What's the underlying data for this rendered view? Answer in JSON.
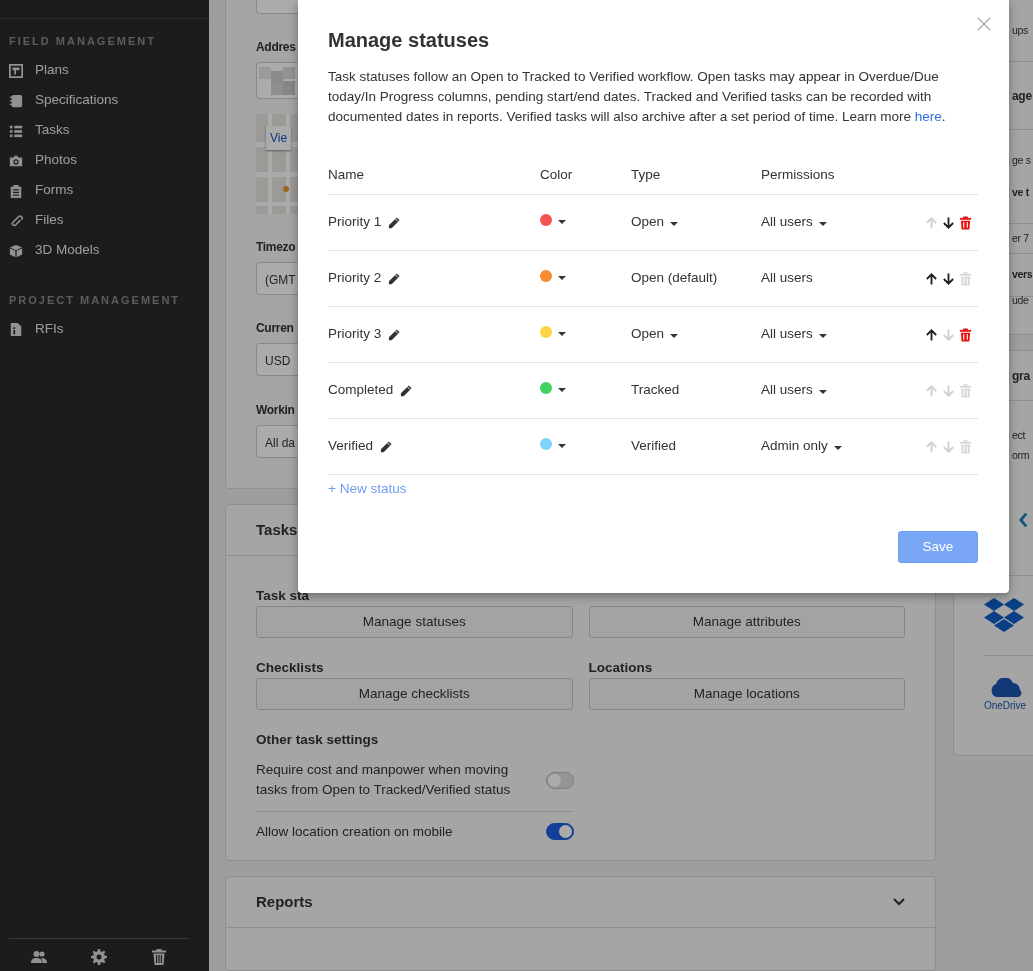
{
  "sidebar": {
    "sections": [
      {
        "heading": "FIELD MANAGEMENT",
        "items": [
          {
            "label": "Plans"
          },
          {
            "label": "Specifications"
          },
          {
            "label": "Tasks"
          },
          {
            "label": "Photos"
          },
          {
            "label": "Forms"
          },
          {
            "label": "Files"
          },
          {
            "label": "3D Models"
          }
        ]
      },
      {
        "heading": "PROJECT MANAGEMENT",
        "items": [
          {
            "label": "RFIs"
          }
        ]
      }
    ]
  },
  "project_card": {
    "address_label": "Addres",
    "map_link": "Vie",
    "fields": [
      {
        "label": "Timezo",
        "value": "(GMT"
      },
      {
        "label": "Curren",
        "value": "USD"
      },
      {
        "label": "Workin",
        "value": "All da"
      }
    ]
  },
  "tasks_card": {
    "title": "Tasks",
    "groups": [
      {
        "label": "Task sta",
        "button": "Manage statuses"
      },
      {
        "button": "Manage attributes"
      },
      {
        "label": "Checklists",
        "button": "Manage checklists"
      },
      {
        "label": "Locations",
        "button": "Manage locations"
      }
    ],
    "other_heading": "Other task settings",
    "toggles": [
      {
        "label": "Require cost and manpower when moving tasks from Open to Tracked/Verified status",
        "on": false
      },
      {
        "label": "Allow location creation on mobile",
        "on": true
      }
    ]
  },
  "reports_card": {
    "title": "Reports",
    "expanded": false
  },
  "right_panel": {
    "rows": [
      {
        "lines": [
          {
            "text": "ups",
            "kind": "text"
          }
        ]
      },
      {
        "lines": [
          {
            "text": "age",
            "kind": "heading"
          }
        ]
      },
      {
        "lines": [
          {
            "text": "ge s",
            "kind": "text"
          },
          {
            "text": "ve t",
            "kind": "strong"
          }
        ]
      },
      {
        "lines": [
          {
            "text": "er 7",
            "kind": "text"
          }
        ]
      },
      {
        "lines": [
          {
            "text": "vers",
            "kind": "strong"
          }
        ]
      },
      {
        "lines": [
          {
            "text": "ude",
            "kind": "text"
          }
        ]
      }
    ],
    "integration_heading": "gra",
    "integration_lines": [
      "ect",
      "orm"
    ],
    "onedrive_label": "OneDrive"
  },
  "modal": {
    "title": "Manage statuses",
    "description": "Task statuses follow an Open to Tracked to Verified workflow. Open tasks may appear in Overdue/Due today/In Progress columns, pending start/end dates. Tracked and Verified tasks can be recorded with documented dates in reports. Verified tasks will also archive after a set period of time. Learn more ",
    "description_link": "here",
    "description_end": ".",
    "columns": [
      "Name",
      "Color",
      "Type",
      "Permissions"
    ],
    "rows": [
      {
        "name": "Priority 1",
        "color": "#f55252",
        "type": "Open",
        "type_menu": true,
        "permissions": "All users",
        "permissions_menu": true,
        "can_move_up": false,
        "can_move_down": true,
        "can_delete": true
      },
      {
        "name": "Priority 2",
        "color": "#f98a30",
        "type": "Open (default)",
        "type_menu": false,
        "permissions": "All users",
        "permissions_menu": false,
        "can_move_up": true,
        "can_move_down": true,
        "can_delete": false
      },
      {
        "name": "Priority 3",
        "color": "#fcd444",
        "type": "Open",
        "type_menu": true,
        "permissions": "All users",
        "permissions_menu": true,
        "can_move_up": true,
        "can_move_down": false,
        "can_delete": true
      },
      {
        "name": "Completed",
        "color": "#40d35f",
        "type": "Tracked",
        "type_menu": false,
        "permissions": "All users",
        "permissions_menu": true,
        "can_move_up": false,
        "can_move_down": false,
        "can_delete": false
      },
      {
        "name": "Verified",
        "color": "#80d4fb",
        "type": "Verified",
        "type_menu": false,
        "permissions": "Admin only",
        "permissions_menu": true,
        "can_move_up": false,
        "can_move_down": false,
        "can_delete": false
      }
    ],
    "new_status": "+ New status",
    "save": "Save"
  }
}
